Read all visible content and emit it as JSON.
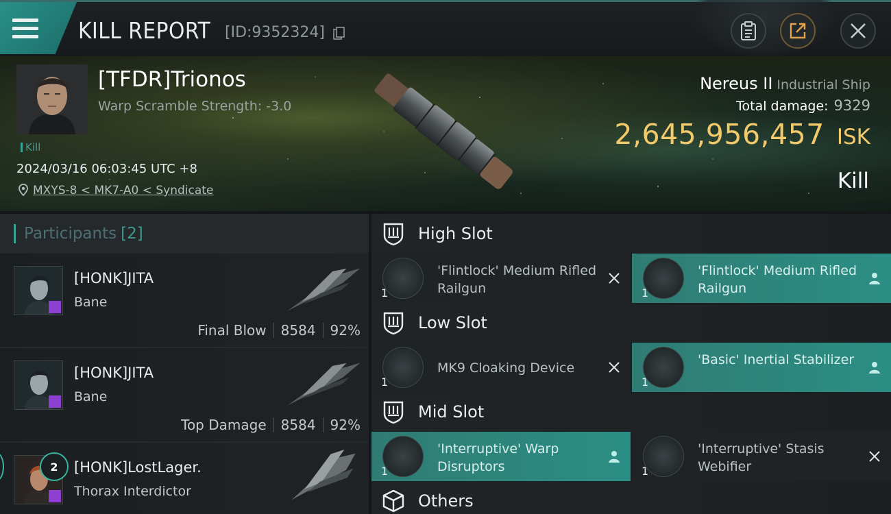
{
  "header": {
    "title": "KILL REPORT",
    "report_id": "[ID:9352324]"
  },
  "victim": {
    "name": "[TFDR]Trionos",
    "warp_scramble": "Warp Scramble Strength: -3.0",
    "kill_tag": "Kill",
    "datetime": "2024/03/16 06:03:45 UTC +8",
    "location": "MXYS-8 < MK7-A0 < Syndicate",
    "ship_name": "Nereus II",
    "ship_class": "Industrial Ship",
    "total_damage_label": "Total damage:",
    "total_damage": "9329",
    "isk_value": "2,645,956,457",
    "isk_unit": "ISK",
    "result": "Kill"
  },
  "participants": {
    "label": "Participants",
    "count": "[2]",
    "rows": [
      {
        "name": "[HONK]JITA",
        "ship": "Bane",
        "role": "Final Blow",
        "damage": "8584",
        "percent": "92%"
      },
      {
        "name": "[HONK]JITA",
        "ship": "Bane",
        "role": "Top Damage",
        "damage": "8584",
        "percent": "92%"
      },
      {
        "name": "[HONK]LostLager.",
        "ship": "Thorax Interdictor",
        "badge": "2"
      }
    ]
  },
  "fitting": {
    "high_slot": {
      "label": "High Slot",
      "modules": [
        {
          "name": "'Flintlock' Medium Rifled Railgun",
          "qty": "1",
          "status": "destroyed"
        },
        {
          "name": "'Flintlock' Medium Rifled Railgun",
          "qty": "1",
          "status": "dropped"
        }
      ]
    },
    "low_slot": {
      "label": "Low Slot",
      "modules": [
        {
          "name": "MK9 Cloaking Device",
          "qty": "1",
          "status": "destroyed"
        },
        {
          "name": "'Basic' Inertial Stabilizer",
          "qty": "1",
          "status": "dropped"
        }
      ]
    },
    "mid_slot": {
      "label": "Mid Slot",
      "modules": [
        {
          "name": "'Interruptive' Warp Disruptors",
          "qty": "1",
          "status": "dropped"
        },
        {
          "name": "'Interruptive' Stasis Webifier",
          "qty": "1",
          "status": "destroyed"
        }
      ]
    },
    "others": {
      "label": "Others"
    }
  },
  "colors": {
    "accent": "#3aa396",
    "isk_gold": "#f2c96b",
    "dropped_bg": "#2b8e84"
  },
  "icons": [
    "menu-icon",
    "copy-icon",
    "clipboard-icon",
    "share-icon",
    "close-icon",
    "location-pin-icon",
    "slot-shield-icon",
    "cube-icon",
    "x-mark-icon",
    "person-icon"
  ]
}
